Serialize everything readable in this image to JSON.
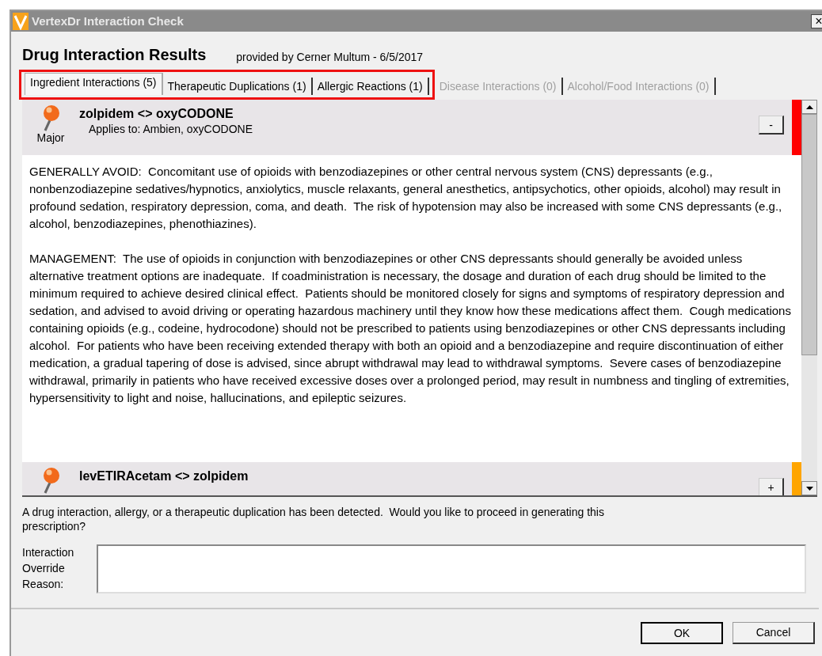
{
  "window": {
    "title": "VertexDr Interaction Check",
    "close": "×"
  },
  "header": {
    "title": "Drug Interaction Results",
    "provider": "provided by Cerner Multum - 6/5/2017"
  },
  "tabs": [
    {
      "label": "Ingredient Interactions (5)",
      "selected": true,
      "disabled": false,
      "highlighted": true
    },
    {
      "label": "Therapeutic Duplications (1)",
      "selected": false,
      "disabled": false,
      "highlighted": true
    },
    {
      "label": "Allergic Reactions (1)",
      "selected": false,
      "disabled": false,
      "highlighted": true
    },
    {
      "label": "Disease Interactions (0)",
      "selected": false,
      "disabled": true,
      "highlighted": false
    },
    {
      "label": "Alcohol/Food Interactions (0)",
      "selected": false,
      "disabled": true,
      "highlighted": false
    }
  ],
  "interactions": [
    {
      "title": "zolpidem <> oxyCODONE",
      "applies_to": "Applies to: Ambien, oxyCODONE",
      "severity": "Major",
      "color": "#ff0000",
      "expanded": true,
      "toggle": "-",
      "paragraphs": [
        "GENERALLY AVOID:  Concomitant use of opioids with benzodiazepines or other central nervous system (CNS) depressants (e.g., nonbenzodiazepine sedatives/hypnotics, anxiolytics, muscle relaxants, general anesthetics, antipsychotics, other opioids, alcohol) may result in profound sedation, respiratory depression, coma, and death.  The risk of hypotension may also be increased with some CNS depressants (e.g., alcohol, benzodiazepines, phenothiazines).",
        "MANAGEMENT:  The use of opioids in conjunction with benzodiazepines or other CNS depressants should generally be avoided unless alternative treatment options are inadequate.  If coadministration is necessary, the dosage and duration of each drug should be limited to the minimum required to achieve desired clinical effect.  Patients should be monitored closely for signs and symptoms of respiratory depression and sedation, and advised to avoid driving or operating hazardous machinery until they know how these medications affect them.  Cough medications containing opioids (e.g., codeine, hydrocodone) should not be prescribed to patients using benzodiazepines or other CNS depressants including alcohol.  For patients who have been receiving extended therapy with both an opioid and a benzodiazepine and require discontinuation of either medication, a gradual tapering of dose is advised, since abrupt withdrawal may lead to withdrawal symptoms.  Severe cases of benzodiazepine withdrawal, primarily in patients who have received excessive doses over a prolonged period, may result in numbness and tingling of extremities, hypersensitivity to light and noise, hallucinations, and epileptic seizures."
      ]
    },
    {
      "title": "levETIRAcetam <> zolpidem",
      "color": "#ffa500",
      "expanded": false,
      "toggle": "+"
    }
  ],
  "prompt": "A drug interaction, allergy, or a therapeutic duplication has been detected.  Would you like to proceed in generating this prescription?",
  "override": {
    "label": "Interaction Override Reason:"
  },
  "buttons": [
    {
      "label": "OK",
      "default": true
    },
    {
      "label": "Cancel",
      "default": false
    }
  ]
}
